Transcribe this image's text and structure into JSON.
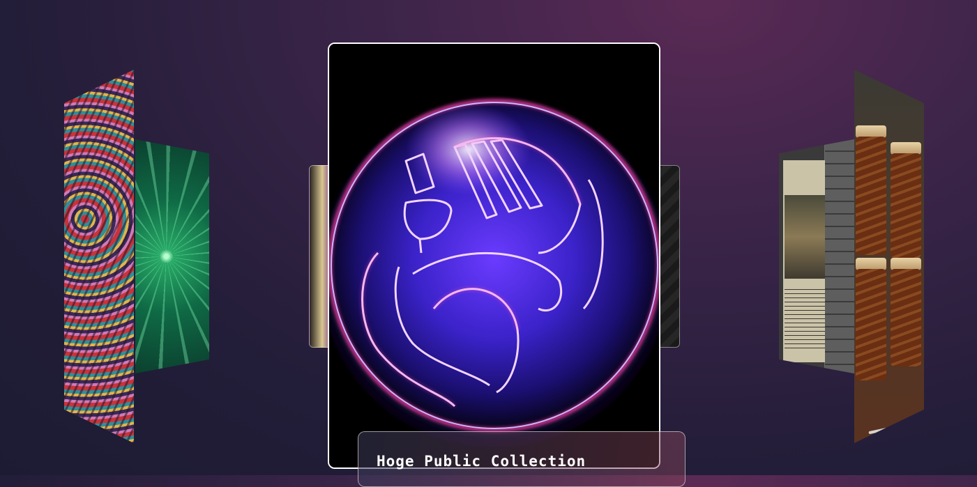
{
  "carousel": {
    "featured": {
      "title": "Hoge Public Collection",
      "artwork_icon": "neon-toilet-logo-icon"
    },
    "cards": [
      {
        "name": "card-psychedelic-art",
        "position": "left-far"
      },
      {
        "name": "card-green-starburst",
        "position": "left-near"
      },
      {
        "name": "card-cartoon",
        "position": "behind-left"
      },
      {
        "name": "card-dark-pattern",
        "position": "behind-right"
      },
      {
        "name": "card-poster-warrior",
        "position": "right-near"
      },
      {
        "name": "card-honey-jars",
        "position": "right-far"
      }
    ]
  },
  "colors": {
    "accent_neon_blue": "#2d3cff",
    "accent_neon_pink": "#ff3fa8",
    "card_border": "#ffffff"
  }
}
